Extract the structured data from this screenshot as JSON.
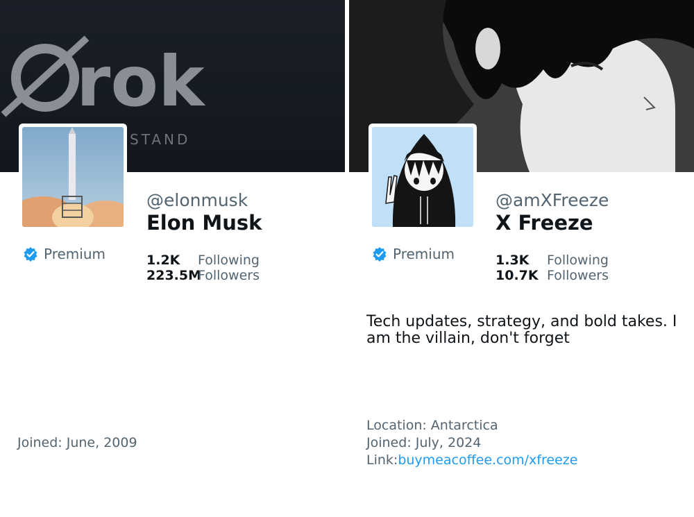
{
  "accent": "#1d9bf0",
  "cards": [
    {
      "banner_text": "rok",
      "banner_subtext": "STAND",
      "handle": "@elonmusk",
      "name": "Elon Musk",
      "premium_label": "Premium",
      "stats": [
        {
          "value": "1.2K",
          "label": "Following"
        },
        {
          "value": "223.5M",
          "label": "Followers"
        }
      ],
      "joined": "Joined: June, 2009"
    },
    {
      "handle": "@amXFreeze",
      "name": "X Freeze",
      "premium_label": "Premium",
      "stats": [
        {
          "value": "1.3K",
          "label": "Following"
        },
        {
          "value": "10.7K",
          "label": "Followers"
        }
      ],
      "bio": "Tech updates, strategy, and bold takes. I am the villain, don't forget",
      "location": "Location: Antarctica",
      "joined": "Joined: July, 2024",
      "link_label": "Link:",
      "link_text": "buymeacoffee.com/xfreeze"
    }
  ]
}
